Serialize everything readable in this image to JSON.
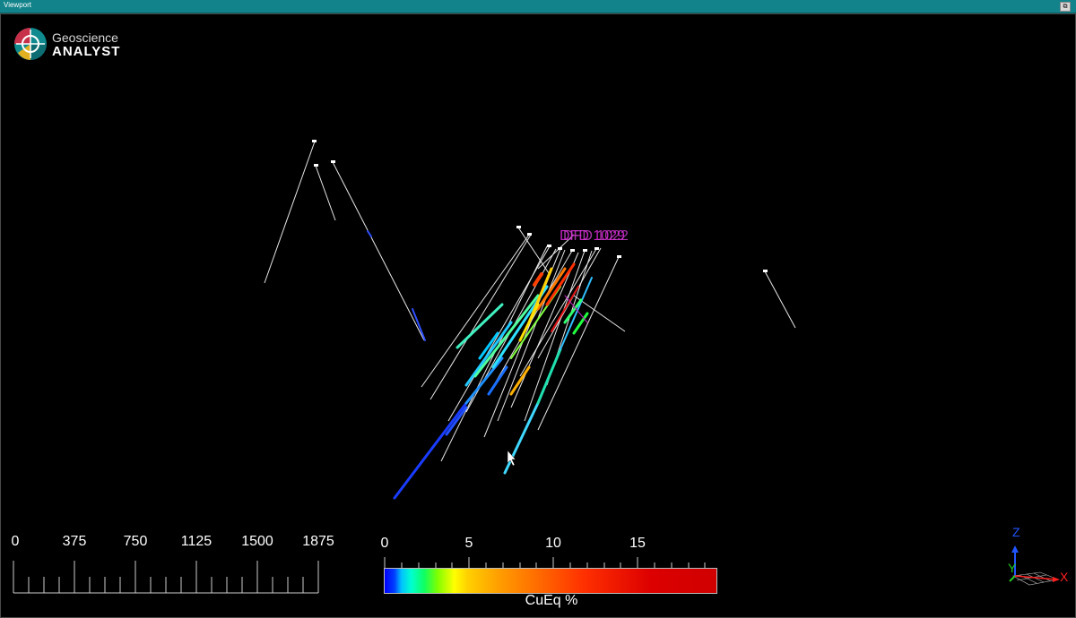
{
  "window": {
    "title": "Viewport",
    "restore_icon": "restore-window-icon"
  },
  "logo": {
    "line1": "Geoscience",
    "line2": "ANALYST",
    "icon": "geoscience-analyst-logo-icon"
  },
  "scene": {
    "hole_labels": [
      "DFD 1029",
      "DFD 1022"
    ],
    "cursor_icon": "mouse-pointer-icon"
  },
  "scale_bar": {
    "labels": [
      "0",
      "375",
      "750",
      "1125",
      "1500",
      "1875"
    ]
  },
  "color_bar": {
    "labels": [
      "0",
      "5",
      "10",
      "15"
    ],
    "title": "CuEq %",
    "colors": {
      "low": "#0000ff",
      "mid": "#ffff00",
      "high": "#d00000"
    }
  },
  "axes": {
    "z": "Z",
    "y": "Y",
    "x": "X",
    "z_color": "#2255ff",
    "y_color": "#22cc22",
    "x_color": "#ff2020"
  }
}
